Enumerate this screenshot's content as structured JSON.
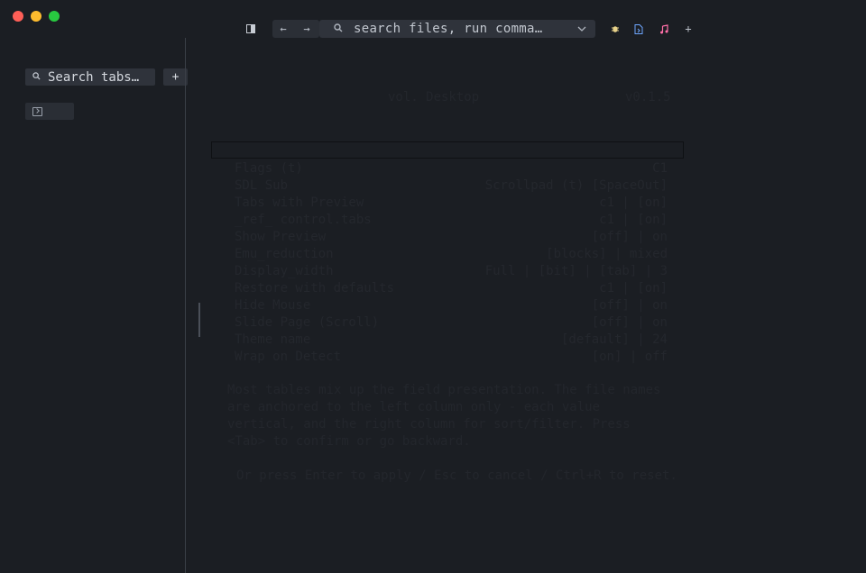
{
  "window": {
    "traffic_lights": {
      "close": "#fe5f57",
      "minimize": "#febc2e",
      "maximize": "#28c840"
    }
  },
  "toolbar": {
    "sidebar_toggle_icon": "sidebar-icon",
    "back_glyph": "←",
    "forward_glyph": "→",
    "command_placeholder": "search files, run comma…",
    "search_glyph": "🔍",
    "chevron_glyph": "⌄",
    "ext_icons": [
      "bug-icon",
      "file-code-icon",
      "music-icon"
    ],
    "add_glyph": "+"
  },
  "sidebar": {
    "search_placeholder": "Search tabs…",
    "new_tab_label": "+",
    "tabs": [
      {
        "icon": "terminal-icon",
        "label": ""
      }
    ]
  },
  "main": {
    "faint_title": "vol. Desktop",
    "faint_version": "v0.1.5",
    "rows": [
      {
        "left": "Flags (t)",
        "right": "C1"
      },
      {
        "left": "SDL Sub",
        "right": "Scrollpad (t) [SpaceOut]"
      },
      {
        "left": "Tabs with Preview",
        "right": "c1 | [on]"
      },
      {
        "left": "_ref_ control.tabs",
        "right": "c1 | [on]"
      },
      {
        "left": "Show Preview",
        "right": "[off] | on"
      },
      {
        "left": "Emu_reduction",
        "right": "[blocks] | mixed"
      },
      {
        "left": "Display_width",
        "right": "Full | [bit] | [tab] | 3"
      },
      {
        "left": "Restore with defaults",
        "right": "c1 | [on]"
      },
      {
        "left": "Hide Mouse",
        "right": "[off] | on"
      },
      {
        "left": "Slide Page (Scroll)",
        "right": "[off] | on"
      },
      {
        "left": "Theme name",
        "right": "[default] | 24"
      },
      {
        "left": "Wrap on Detect",
        "right": "[on] | off"
      }
    ],
    "para1": "Most tables mix up the field presentation. The file names are anchored to the left column only - each value vertical, and the right column for sort/filter. Press <Tab> to confirm or go backward.",
    "para2": "Or press Enter to apply / Esc to cancel / Ctrl+R to reset."
  }
}
